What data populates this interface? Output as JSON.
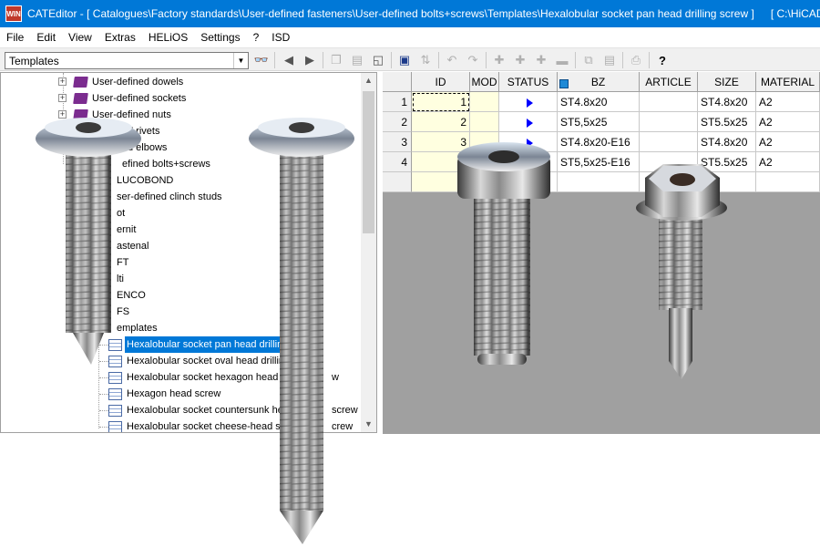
{
  "window": {
    "title": "CATEditor - [ Catalogues\\Factory standards\\User-defined fasteners\\User-defined bolts+screws\\Templates\\Hexalobular socket pan head drilling screw ]",
    "path_right": "[ C:\\HiCAD\\",
    "icon_text": "WIN"
  },
  "menu": [
    "File",
    "Edit",
    "View",
    "Extras",
    "HELiOS",
    "Settings",
    "?",
    "ISD"
  ],
  "toolbar": {
    "combo_value": "Templates",
    "binoculars_icon": "search-icon",
    "buttons": [
      "back-icon",
      "forward-icon",
      "copy-icon",
      "paste-icon",
      "new-icon",
      "save-icon",
      "sort-icon",
      "undo-icon",
      "redo-icon",
      "add-row-icon",
      "add-col-icon",
      "insert-icon",
      "delete-icon",
      "copy-table-icon",
      "print-icon",
      "help-icon"
    ],
    "help_glyph": "?"
  },
  "tree": {
    "items": [
      {
        "label": "User-defined dowels",
        "type": "book",
        "expander": "+"
      },
      {
        "label": "User-defined sockets",
        "type": "book",
        "expander": "+"
      },
      {
        "label": "User-defined nuts",
        "type": "book",
        "expander": "+"
      },
      {
        "label": "d rivets",
        "type": "book",
        "expander": "+"
      },
      {
        "label": "d elbows",
        "type": "book",
        "expander": "+"
      },
      {
        "label": "efined bolts+screws",
        "type": "book",
        "expander": "-"
      },
      {
        "label": "LUCOBOND",
        "type": "folder"
      },
      {
        "label": "ser-defined clinch studs",
        "type": "folder"
      },
      {
        "label": "ot",
        "type": "folder"
      },
      {
        "label": "ernit",
        "type": "folder"
      },
      {
        "label": "astenal",
        "type": "folder"
      },
      {
        "label": "FT",
        "type": "folder"
      },
      {
        "label": "lti",
        "type": "folder"
      },
      {
        "label": "ENCO",
        "type": "folder"
      },
      {
        "label": "FS",
        "type": "folder"
      },
      {
        "label": "emplates",
        "type": "folder"
      },
      {
        "label": "Hexalobular socket pan head drillin",
        "type": "template",
        "selected": true
      },
      {
        "label": "Hexalobular socket oval head drillin",
        "type": "template"
      },
      {
        "label": "Hexalobular socket hexagon head",
        "type": "template",
        "suffix": "w"
      },
      {
        "label": "Hexagon head screw",
        "type": "template"
      },
      {
        "label": "Hexalobular socket countersunk he",
        "type": "template",
        "suffix": "screw"
      },
      {
        "label": "Hexalobular socket cheese-head s",
        "type": "template",
        "suffix": "crew"
      }
    ]
  },
  "grid": {
    "columns": [
      "ID",
      "MOD",
      "STATUS",
      "BZ",
      "ARTICLE",
      "SIZE",
      "MATERIAL"
    ],
    "rows": [
      {
        "num": "1",
        "id": "1",
        "mod": "",
        "bz": "ST4.8x20",
        "article": "",
        "size": "ST4.8x20",
        "material": "A2"
      },
      {
        "num": "2",
        "id": "2",
        "mod": "",
        "bz": "ST5,5x25",
        "article": "",
        "size": "ST5.5x25",
        "material": "A2"
      },
      {
        "num": "3",
        "id": "3",
        "mod": "",
        "bz": "ST4.8x20-E16",
        "article": "",
        "size": "ST4.8x20",
        "material": "A2"
      },
      {
        "num": "4",
        "id": "4",
        "mod": "",
        "bz": "ST5,5x25-E16",
        "article": "",
        "size": "ST5.5x25",
        "material": "A2"
      }
    ]
  },
  "colors": {
    "titlebar": "#0078d7",
    "selection": "#0078d7",
    "status_arrow": "#0000ff",
    "book": "#7b2c8f"
  }
}
